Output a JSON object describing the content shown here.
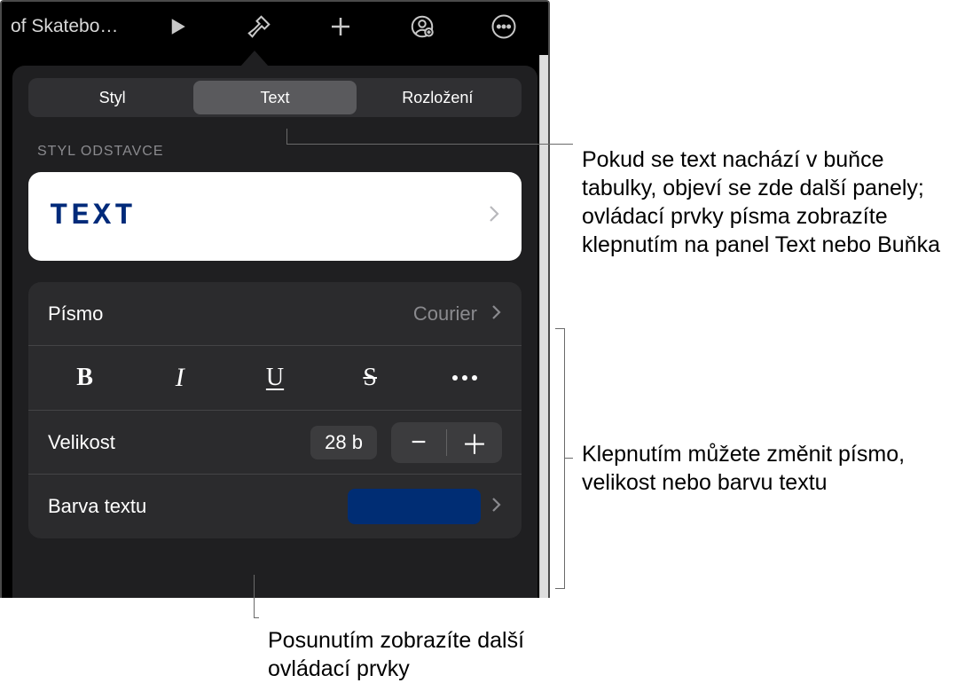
{
  "toolbar": {
    "title": "of Skatebo…"
  },
  "tabs": {
    "style": "Styl",
    "text": "Text",
    "layout": "Rozložení"
  },
  "section_label": "STYL ODSTAVCE",
  "paragraph_style": {
    "name": "TEXT"
  },
  "font_row": {
    "label": "Písmo",
    "value": "Courier"
  },
  "style_icons": {
    "bold": "B",
    "italic": "I",
    "underline": "U",
    "strike": "S"
  },
  "size_row": {
    "label": "Velikost",
    "value": "28 b"
  },
  "color_row": {
    "label": "Barva textu",
    "swatch_color": "#002d74"
  },
  "callouts": {
    "right1": "Pokud se text nachází v buňce tabulky, objeví se zde další panely; ovládací prvky písma zobrazíte klepnutím na panel Text nebo Buňka",
    "right2": "Klepnutím můžete změnit písmo, velikost nebo barvu textu",
    "bottom": "Posunutím zobrazíte další ovládací prvky"
  }
}
